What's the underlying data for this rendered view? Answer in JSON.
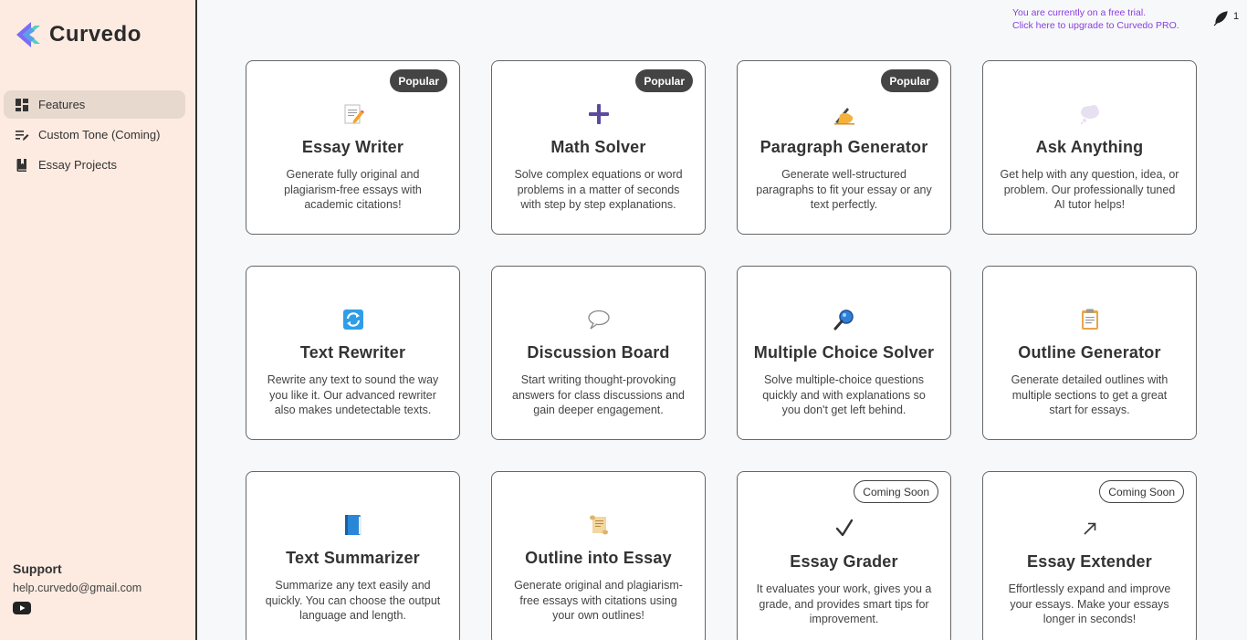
{
  "brand": {
    "name": "Curvedo"
  },
  "sidebar": {
    "items": [
      {
        "label": "Features",
        "icon": "grid-icon",
        "active": true
      },
      {
        "label": "Custom Tone (Coming)",
        "icon": "edit-lines-icon"
      },
      {
        "label": "Essay Projects",
        "icon": "bookmark-book-icon"
      }
    ]
  },
  "support": {
    "title": "Support",
    "email": "help.curvedo@gmail.com",
    "icon": "youtube-icon"
  },
  "trial": {
    "line1": "You are currently on a free trial.",
    "line2": "Click here to upgrade to Curvedo PRO."
  },
  "credits": {
    "icon": "feather-icon",
    "count": "1"
  },
  "colors": {
    "accent": "#8a3fe0",
    "sidebar_bg": "#fdebe1",
    "badge_bg": "#444444"
  },
  "cards": [
    {
      "title": "Essay Writer",
      "badge": "Popular",
      "icon": "memo-pencil-icon",
      "desc": "Generate fully original and plagiarism-free essays with academic citations!"
    },
    {
      "title": "Math Solver",
      "badge": "Popular",
      "icon": "plus-icon",
      "desc": "Solve complex equations or word problems in a matter of seconds with step by step explanations."
    },
    {
      "title": "Paragraph Generator",
      "badge": "Popular",
      "icon": "writing-hand-icon",
      "desc": "Generate well-structured paragraphs to fit your essay or any text perfectly."
    },
    {
      "title": "Ask Anything",
      "badge": "",
      "icon": "thought-bubble-icon",
      "desc": "Get help with any question, idea, or problem. Our professionally tuned AI tutor helps!"
    },
    {
      "title": "Text Rewriter",
      "badge": "",
      "icon": "refresh-icon",
      "desc": "Rewrite any text to sound the way you like it. Our advanced rewriter also makes undetectable texts."
    },
    {
      "title": "Discussion Board",
      "badge": "",
      "icon": "speech-bubble-icon",
      "desc": "Start writing thought-provoking answers for class discussions and gain deeper engagement."
    },
    {
      "title": "Multiple Choice Solver",
      "badge": "",
      "icon": "magnifier-icon",
      "desc": "Solve multiple-choice questions quickly and with explanations so you don't get left behind."
    },
    {
      "title": "Outline Generator",
      "badge": "",
      "icon": "clipboard-icon",
      "desc": "Generate detailed outlines with multiple sections to get a great start for essays."
    },
    {
      "title": "Text Summarizer",
      "badge": "",
      "icon": "blue-book-icon",
      "desc": "Summarize any text easily and quickly. You can choose the output language and length."
    },
    {
      "title": "Outline into Essay",
      "badge": "",
      "icon": "scroll-icon",
      "desc": "Generate original and plagiarism-free essays with citations using your own outlines!"
    },
    {
      "title": "Essay Grader",
      "badge": "Coming Soon",
      "icon": "check-mark-icon",
      "desc": "It evaluates your work, gives you a grade, and provides smart tips for improvement."
    },
    {
      "title": "Essay Extender",
      "badge": "Coming Soon",
      "icon": "arrow-up-right-icon",
      "desc": "Effortlessly expand and improve your essays. Make your essays longer in seconds!"
    }
  ]
}
